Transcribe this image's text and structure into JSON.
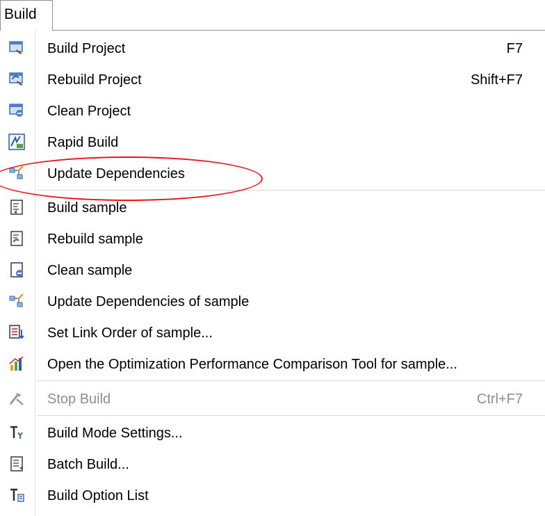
{
  "menubar": {
    "title": "Build"
  },
  "items": [
    {
      "label": "Build Project",
      "shortcut": "F7",
      "icon": "build-project-icon"
    },
    {
      "label": "Rebuild Project",
      "shortcut": "Shift+F7",
      "icon": "rebuild-project-icon"
    },
    {
      "label": "Clean Project",
      "shortcut": "",
      "icon": "clean-project-icon"
    },
    {
      "label": "Rapid Build",
      "shortcut": "",
      "icon": "rapid-build-icon"
    },
    {
      "label": "Update Dependencies",
      "shortcut": "",
      "icon": "update-dependencies-icon"
    },
    {
      "label": "Build sample",
      "shortcut": "",
      "icon": "build-sample-icon"
    },
    {
      "label": "Rebuild sample",
      "shortcut": "",
      "icon": "rebuild-sample-icon"
    },
    {
      "label": "Clean sample",
      "shortcut": "",
      "icon": "clean-sample-icon"
    },
    {
      "label": "Update Dependencies of sample",
      "shortcut": "",
      "icon": "update-dependencies-sample-icon"
    },
    {
      "label": "Set Link Order of sample...",
      "shortcut": "",
      "icon": "link-order-icon"
    },
    {
      "label": "Open the Optimization Performance Comparison Tool for sample...",
      "shortcut": "",
      "icon": "bar-chart-icon"
    },
    {
      "label": "Stop Build",
      "shortcut": "Ctrl+F7",
      "icon": "stop-build-icon",
      "disabled": true
    },
    {
      "label": "Build Mode Settings...",
      "shortcut": "",
      "icon": "build-mode-icon"
    },
    {
      "label": "Batch Build...",
      "shortcut": "",
      "icon": "batch-build-icon"
    },
    {
      "label": "Build Option List",
      "shortcut": "",
      "icon": "build-option-list-icon"
    }
  ],
  "annotation": {
    "color": "#e8141c"
  }
}
